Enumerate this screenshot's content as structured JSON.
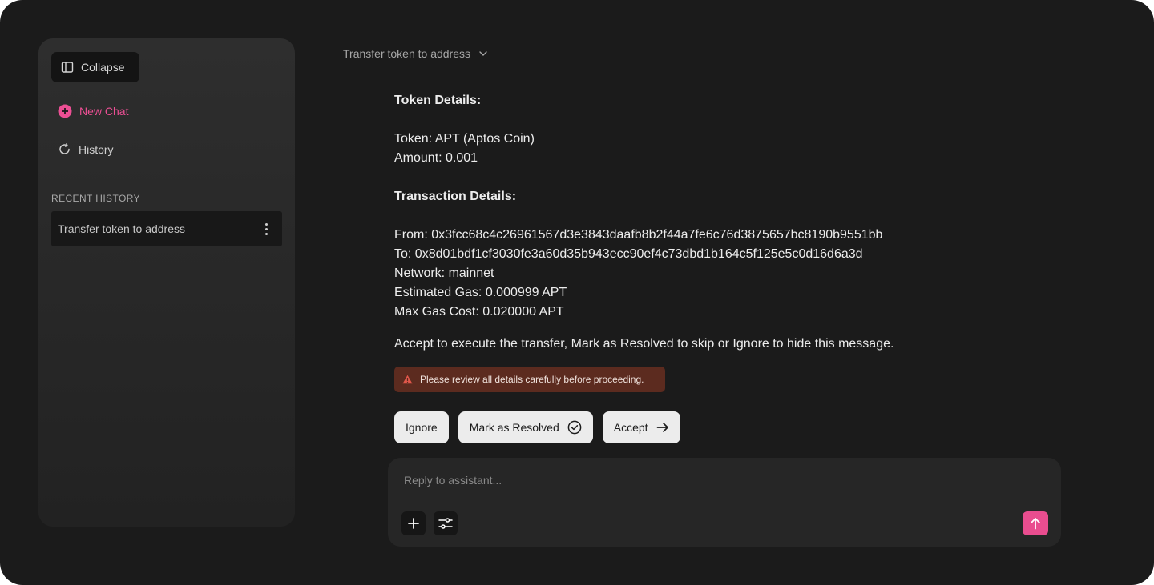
{
  "sidebar": {
    "collapse_label": "Collapse",
    "new_chat_label": "New Chat",
    "history_label": "History",
    "recent_history_label": "RECENT HISTORY",
    "recent_items": [
      {
        "label": "Transfer token to address"
      }
    ]
  },
  "header": {
    "chat_title": "Transfer token to address"
  },
  "message": {
    "token_heading": "Token Details:",
    "token_line": "Token: APT (Aptos Coin)",
    "amount_line": "Amount: 0.001",
    "tx_heading": "Transaction Details:",
    "from_line": "From: 0x3fcc68c4c26961567d3e3843daafb8b2f44a7fe6c76d3875657bc8190b9551bb",
    "to_line": "To: 0x8d01bdf1cf3030fe3a60d35b943ecc90ef4c73dbd1b164c5f125e5c0d16d6a3d",
    "network_line": "Network: mainnet",
    "gas_line": "Estimated Gas: 0.000999 APT",
    "max_gas_line": "Max Gas Cost: 0.020000 APT",
    "instruction": "Accept to execute the transfer, Mark as Resolved to skip or Ignore to hide this message.",
    "warning": "Please review all details carefully before proceeding."
  },
  "actions": {
    "ignore_label": "Ignore",
    "resolve_label": "Mark as Resolved",
    "accept_label": "Accept"
  },
  "composer": {
    "placeholder": "Reply to assistant...",
    "value": ""
  },
  "colors": {
    "accent": "#ec4f94",
    "background": "#1b1b1b",
    "warning_bg": "#5c2b1f",
    "warning_icon": "#e0574a"
  },
  "icons": {
    "collapse": "sidebar-panel-icon",
    "new_chat": "plus-circle-icon",
    "history": "history-refresh-icon",
    "more": "kebab-icon",
    "title_dropdown": "chevron-down-icon",
    "warning": "warning-triangle-icon",
    "resolve": "check-circle-icon",
    "accept": "arrow-right-icon",
    "attach": "plus-icon",
    "settings": "sliders-icon",
    "send": "arrow-up-icon"
  }
}
